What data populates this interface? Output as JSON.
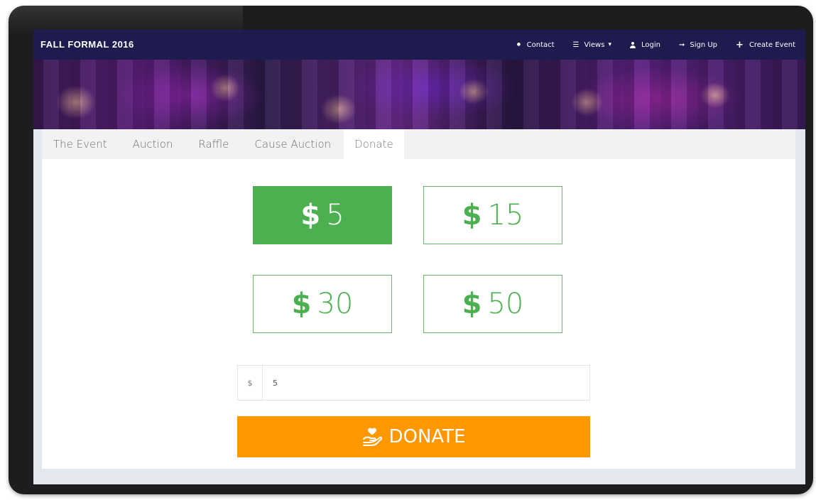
{
  "navbar": {
    "brand": "FALL FORMAL 2016",
    "items": [
      {
        "label": "Contact",
        "icon": "info-circle-icon"
      },
      {
        "label": "Views",
        "icon": "list-icon"
      },
      {
        "label": "Login",
        "icon": "user-icon"
      },
      {
        "label": "Sign Up",
        "icon": "sign-in-icon"
      },
      {
        "label": "Create Event",
        "icon": "plus-icon"
      }
    ]
  },
  "tabs": [
    "The Event",
    "Auction",
    "Raffle",
    "Cause Auction",
    "Donate"
  ],
  "active_tab": "Donate",
  "amounts": [
    {
      "symbol": "$",
      "value": "5",
      "selected": true
    },
    {
      "symbol": "$",
      "value": "15",
      "selected": false
    },
    {
      "symbol": "$",
      "value": "30",
      "selected": false
    },
    {
      "symbol": "$",
      "value": "50",
      "selected": false
    }
  ],
  "custom_amount": {
    "addon": "$",
    "value": "5"
  },
  "donate_button": {
    "label": "DONATE",
    "icon": "heart-hand-icon"
  },
  "colors": {
    "navbar": "#1e1c4f",
    "green": "#4caf50",
    "orange": "#ff9800"
  }
}
